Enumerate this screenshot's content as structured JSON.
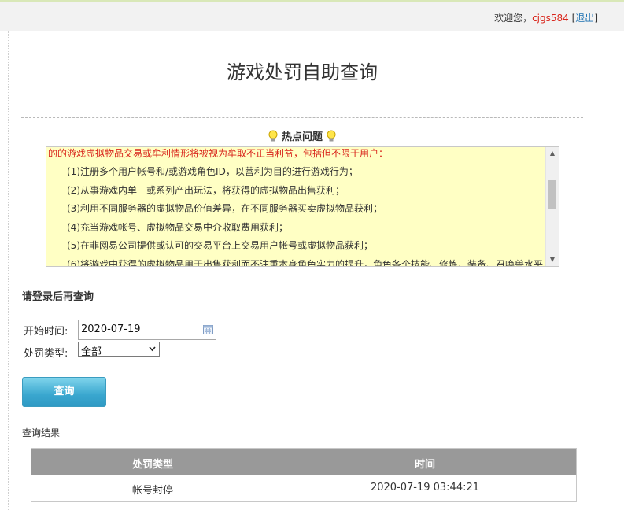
{
  "header": {
    "welcome": "欢迎您，",
    "username": "cjgs584",
    "logout_open": " [",
    "logout_label": "退出",
    "logout_close": "]"
  },
  "page": {
    "title": "游戏处罚自助查询"
  },
  "hot_issues": {
    "title": "热点问题",
    "intro": "的的游戏虚拟物品交易或牟利情形将被视为牟取不正当利益，包括但不限于用户：",
    "items": [
      "(1)注册多个用户帐号和/或游戏角色ID，以营利为目的进行游戏行为；",
      "(2)从事游戏内单一或系列产出玩法，将获得的虚拟物品出售获利；",
      "(3)利用不同服务器的虚拟物品价值差异，在不同服务器买卖虚拟物品获利；",
      "(4)充当游戏帐号、虚拟物品交易中介收取费用获利；",
      "(5)在非网易公司提供或认可的交易平台上交易用户帐号或虚拟物品获利；",
      "(6)将游戏中获得的虚拟物品用于出售获利而不注重本身角色实力的提升，角色各个技能、修炼、装备、召唤兽水平"
    ]
  },
  "login_hint": "请登录后再查询",
  "form": {
    "start_label": "开始时间:",
    "start_value": "2020-07-19",
    "type_label": "处罚类型:",
    "type_value": "全部",
    "query_button": "查询"
  },
  "results": {
    "title": "查询结果",
    "columns": [
      "处罚类型",
      "时间"
    ],
    "rows": [
      {
        "type": "帐号封停",
        "time": "2020-07-19 03:44:21"
      }
    ]
  },
  "icons": {
    "bulb": "lightbulb-icon",
    "calendar": "calendar-icon",
    "dropdown": "chevron-down-icon"
  },
  "colors": {
    "notice_bg": "#ffffc4",
    "notice_red": "#d9261c",
    "link_blue": "#1a6fb0",
    "button": "#3aa7cf",
    "table_head": "#999999"
  }
}
